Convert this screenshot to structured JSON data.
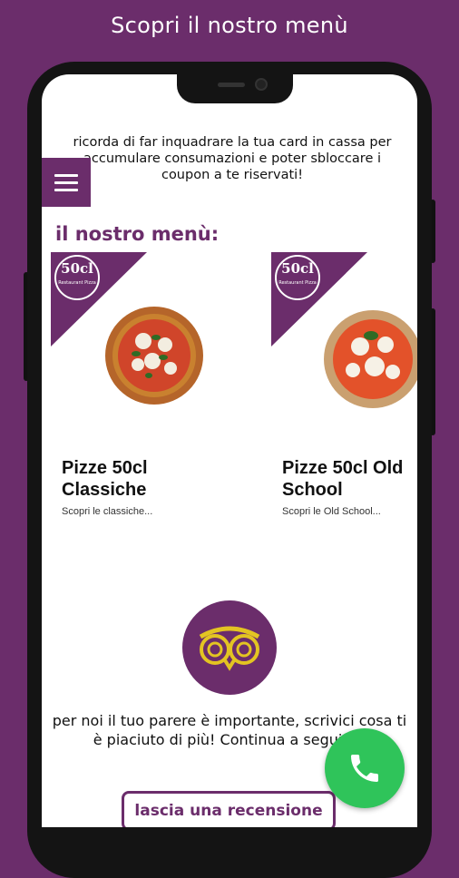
{
  "header": {
    "title": "Scopri il nostro menù"
  },
  "notice": "ricorda di far inquadrare la tua card in cassa per accumulare consumazioni e poter sbloccare i coupon a te riservati!",
  "menu_section": {
    "title": "il nostro menù:",
    "cards": [
      {
        "logo_text": "50cl",
        "logo_sub": "Restaurant Pizza",
        "title": "Pizze 50cl Classiche",
        "description": "Scopri le classiche..."
      },
      {
        "logo_text": "50cl",
        "logo_sub": "Restaurant Pizza",
        "title": "Pizze 50cl Old School",
        "description": "Scopri le Old School..."
      }
    ]
  },
  "review": {
    "text": "per noi il tuo parere è importante, scrivici cosa ti è piaciuto di più! Continua a seguirci!",
    "button_label": "lascia una recensione"
  },
  "colors": {
    "brand": "#6b2d6b",
    "call": "#2fc45a"
  },
  "icons": {
    "menu": "hamburger-icon",
    "review": "tripadvisor-owl-icon",
    "call": "phone-icon"
  }
}
